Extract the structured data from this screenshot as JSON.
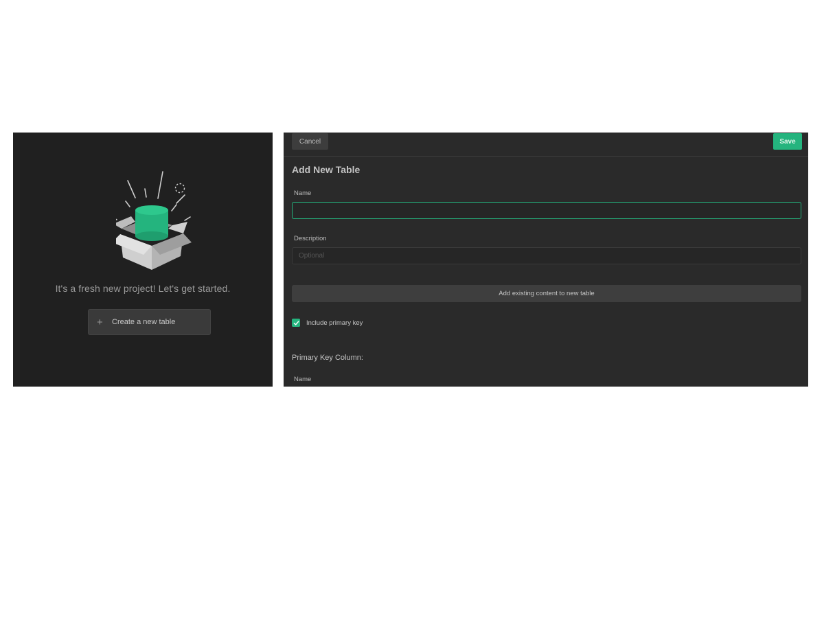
{
  "empty_state": {
    "message": "It's a fresh new project! Let's get started.",
    "create_button_label": "Create a new table",
    "accent_color": "#24b47e"
  },
  "form": {
    "cancel_label": "Cancel",
    "save_label": "Save",
    "title": "Add New Table",
    "name_label": "Name",
    "name_value": "",
    "description_label": "Description",
    "description_placeholder": "Optional",
    "description_value": "",
    "add_existing_label": "Add existing content to new table",
    "include_primary_key_label": "Include primary key",
    "include_primary_key_checked": true,
    "primary_key_section_title": "Primary Key Column:",
    "primary_key_name_label": "Name"
  },
  "colors": {
    "accent": "#24b47e",
    "panel_dark": "#202020",
    "panel": "#2a2a2a"
  }
}
